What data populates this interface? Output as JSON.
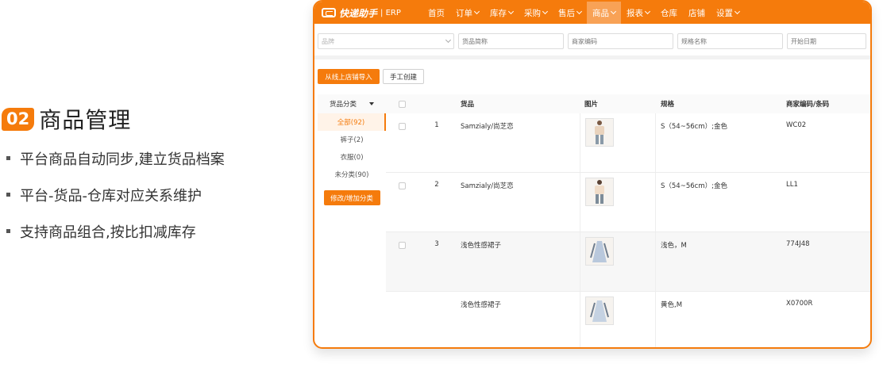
{
  "promo": {
    "badge": "02",
    "heading": "商品管理",
    "bullets": [
      "平台商品自动同步,建立货品档案",
      "平台-货品-仓库对应关系维护",
      "支持商品组合,按比扣减库存"
    ]
  },
  "app": {
    "logo_text": "快递助手",
    "logo_sub": "| ERP",
    "nav": [
      {
        "label": "首页",
        "dropdown": false
      },
      {
        "label": "订单",
        "dropdown": true
      },
      {
        "label": "库存",
        "dropdown": true
      },
      {
        "label": "采购",
        "dropdown": true
      },
      {
        "label": "售后",
        "dropdown": true
      },
      {
        "label": "商品",
        "dropdown": true,
        "active": true
      },
      {
        "label": "报表",
        "dropdown": true
      },
      {
        "label": "仓库",
        "dropdown": false
      },
      {
        "label": "店铺",
        "dropdown": false
      },
      {
        "label": "设置",
        "dropdown": true
      }
    ],
    "filters": {
      "brand_placeholder": "品牌",
      "goods_short_name_placeholder": "货品简称",
      "merchant_code_placeholder": "商家编码",
      "spec_name_placeholder": "规格名称",
      "start_date_placeholder": "开始日期"
    },
    "buttons": {
      "import_label": "从线上店铺导入",
      "manual_label": "手工创建"
    },
    "category": {
      "header": "货品分类",
      "items": [
        "全部(92)",
        "裤子(2)",
        "衣服(0)",
        "未分类(90)"
      ],
      "edit_button": "修改/增加分类"
    },
    "table": {
      "headers": {
        "goods": "货品",
        "image": "图片",
        "spec": "规格",
        "code": "商家编码/条码"
      },
      "rows": [
        {
          "index": "1",
          "name": "Samzialy/尚芝恋",
          "spec": "S（54~56cm）;金色",
          "code": "WC02"
        },
        {
          "index": "2",
          "name": "Samzialy/尚芝恋",
          "spec": "S（54~56cm）;金色",
          "code": "LL1"
        },
        {
          "index": "3",
          "name": "浅色性感裙子",
          "spec": "浅色，M",
          "code": "774J48"
        },
        {
          "index": "",
          "name": "浅色性感裙子",
          "spec": "黄色,M",
          "code": "X0700R"
        }
      ]
    },
    "colors": {
      "accent": "#f57b0c",
      "active_nav": "#f8a256"
    }
  }
}
